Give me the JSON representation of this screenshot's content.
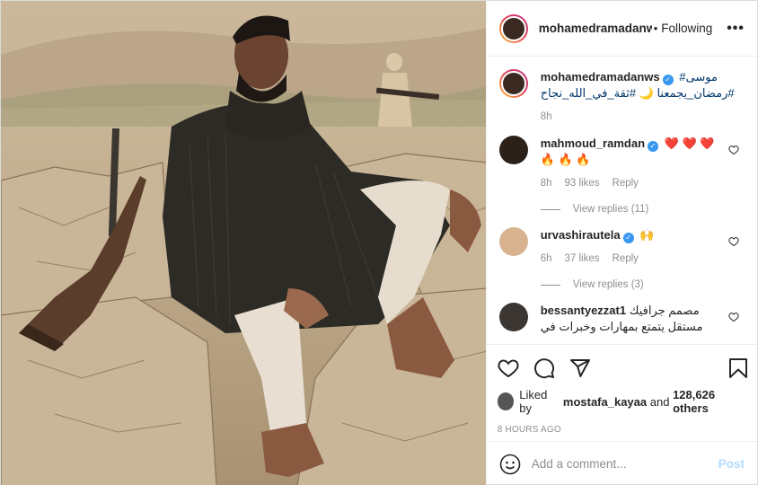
{
  "post": {
    "header": {
      "username": "mohamedramadanws",
      "separator": "•",
      "follow_label": "Following",
      "more_label": "•••"
    },
    "caption": {
      "username": "mohamedramadanws",
      "text_line1": "موسى#",
      "text_line2": "#رمضان_يجمعنا 🌙 #ثقة_في_الله_نجاح",
      "time": "8h"
    },
    "comments": [
      {
        "username": "mahmoud_ramdan",
        "text_line1": "❤️ ❤️ ❤️",
        "text_line2": "🔥 🔥 🔥",
        "time": "8h",
        "likes": "93 likes",
        "reply": "Reply",
        "view_replies": "View replies (11)"
      },
      {
        "username": "urvashirautela",
        "text_line1": "🙌",
        "time": "6h",
        "likes": "37 likes",
        "reply": "Reply",
        "view_replies": "View replies (3)"
      },
      {
        "username": "bessantyezzat1",
        "text_line1": "مصمم جرافيك",
        "text_line2": "مستقل يتمتع بمهارات وخبرات في"
      }
    ],
    "liked_by": {
      "prefix": "Liked by",
      "user": "mostafa_kayaa",
      "middle": "and",
      "others": "128,626 others"
    },
    "time_ago": "8 HOURS AGO",
    "add_comment": {
      "placeholder": "Add a comment...",
      "post_label": "Post"
    },
    "icons": {
      "like": "heart-icon",
      "comment": "comment-icon",
      "share": "share-icon",
      "save": "bookmark-icon",
      "emoji": "emoji-icon",
      "verified": "verified-icon"
    },
    "colors": {
      "link": "#00376b",
      "verified": "#3897f0",
      "muted": "#8e8e8e",
      "post_disabled": "#b3dbff"
    }
  }
}
